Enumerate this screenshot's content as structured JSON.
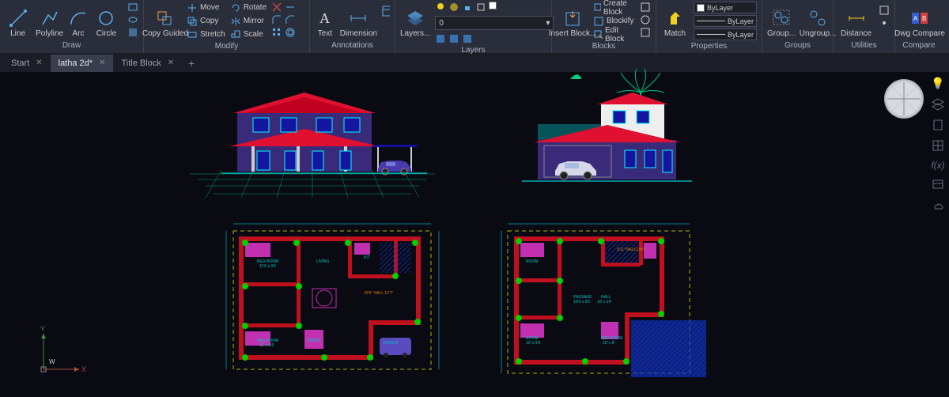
{
  "ribbon": {
    "draw": {
      "label": "Draw",
      "line": "Line",
      "polyline": "Polyline",
      "arc": "Arc",
      "circle": "Circle"
    },
    "modify": {
      "label": "Modify",
      "copy_guided": "Copy Guided",
      "move": "Move",
      "copy": "Copy",
      "stretch": "Stretch",
      "rotate": "Rotate",
      "mirror": "Mirror",
      "scale": "Scale"
    },
    "annotations": {
      "label": "Annotations",
      "text": "Text",
      "dimension": "Dimension"
    },
    "layers": {
      "label": "Layers",
      "layers_btn": "Layers...",
      "current": "0"
    },
    "blocks": {
      "label": "Blocks",
      "insert": "Insert Block...",
      "create": "Create Block",
      "blockify": "Blockify",
      "edit": "Edit Block"
    },
    "properties": {
      "label": "Properties",
      "match": "Match",
      "bylayer1": "ByLayer",
      "bylayer2": "ByLayer",
      "bylayer3": "ByLayer"
    },
    "groups": {
      "label": "Groups",
      "group": "Group...",
      "ungroup": "Ungroup..."
    },
    "utilities": {
      "label": "Utilities",
      "distance": "Distance"
    },
    "compare": {
      "label": "Compare",
      "dwg": "Dwg Compare"
    }
  },
  "tabs": {
    "start": "Start",
    "latha": "latha 2d*",
    "title_block": "Title Block"
  },
  "ucs": {
    "x": "X",
    "y": "Y",
    "w": "W"
  },
  "fx_label": "f(x)"
}
